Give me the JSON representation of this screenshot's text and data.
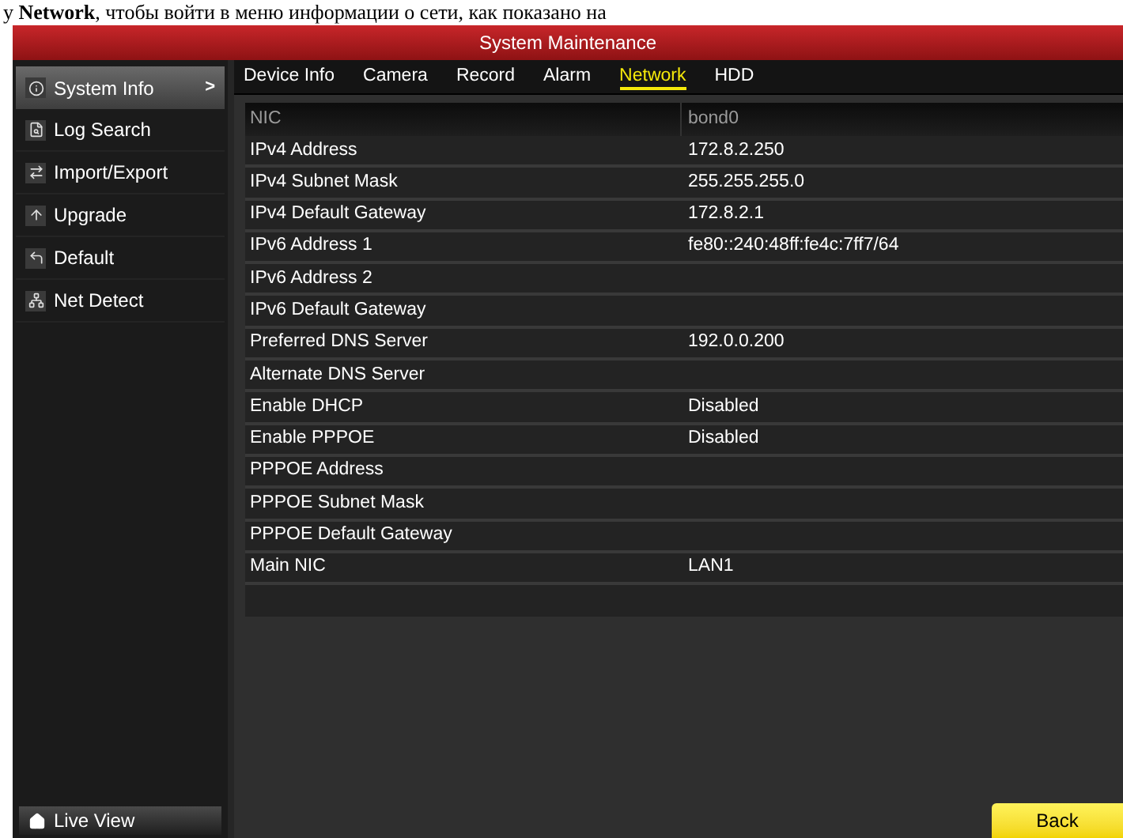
{
  "caption": "у **Network**, чтобы войти в меню информации о сети, как показано на",
  "window": {
    "title": "System Maintenance"
  },
  "sidebar": {
    "items": [
      {
        "label": "System Info",
        "selected": true
      },
      {
        "label": "Log Search",
        "selected": false
      },
      {
        "label": "Import/Export",
        "selected": false
      },
      {
        "label": "Upgrade",
        "selected": false
      },
      {
        "label": "Default",
        "selected": false
      },
      {
        "label": "Net Detect",
        "selected": false
      }
    ],
    "selected_arrow": ">",
    "live_view": "Live View"
  },
  "tabs": [
    {
      "label": "Device Info",
      "selected": false
    },
    {
      "label": "Camera",
      "selected": false
    },
    {
      "label": "Record",
      "selected": false
    },
    {
      "label": "Alarm",
      "selected": false
    },
    {
      "label": "Network",
      "selected": true
    },
    {
      "label": "HDD",
      "selected": false
    }
  ],
  "table": {
    "header": [
      "NIC",
      "bond0"
    ],
    "rows": [
      [
        "IPv4 Address",
        "172.8.2.250"
      ],
      [
        "IPv4 Subnet Mask",
        "255.255.255.0"
      ],
      [
        "IPv4 Default Gateway",
        "172.8.2.1"
      ],
      [
        "IPv6 Address 1",
        "fe80::240:48ff:fe4c:7ff7/64"
      ],
      [
        "IPv6 Address 2",
        ""
      ],
      [
        "IPv6 Default Gateway",
        ""
      ],
      [
        "Preferred DNS Server",
        "192.0.0.200"
      ],
      [
        "Alternate DNS Server",
        ""
      ],
      [
        "Enable DHCP",
        "Disabled"
      ],
      [
        "Enable PPPOE",
        "Disabled"
      ],
      [
        "PPPOE Address",
        ""
      ],
      [
        "PPPOE Subnet Mask",
        ""
      ],
      [
        "PPPOE Default Gateway",
        ""
      ],
      [
        "Main NIC",
        "LAN1"
      ]
    ]
  },
  "buttons": {
    "back": "Back"
  }
}
